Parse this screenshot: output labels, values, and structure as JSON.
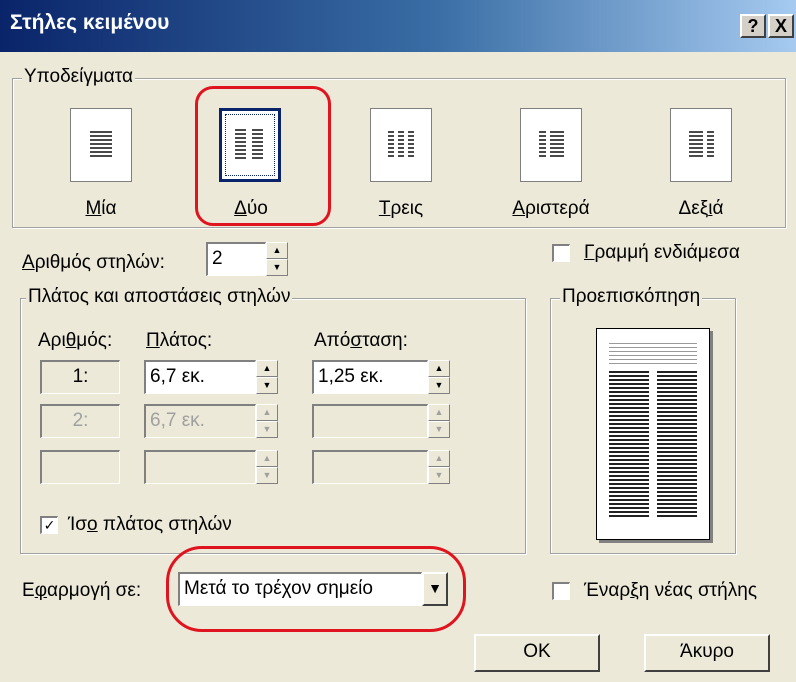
{
  "window": {
    "title": "Στήλες κειμένου",
    "help_label": "?",
    "close_label": "X"
  },
  "presets": {
    "legend": "Υποδείγματα",
    "items": [
      {
        "pre": "",
        "acc": "Μ",
        "post": "ία",
        "icon": "one-column-icon"
      },
      {
        "pre": "",
        "acc": "Δ",
        "post": "ύο",
        "icon": "two-columns-icon"
      },
      {
        "pre": "",
        "acc": "Τ",
        "post": "ρεις",
        "icon": "three-columns-icon"
      },
      {
        "pre": "",
        "acc": "Α",
        "post": "ριστερά",
        "icon": "left-columns-icon"
      },
      {
        "pre": "Δεξ",
        "acc": "ι",
        "post": "ά",
        "icon": "right-columns-icon"
      }
    ],
    "selected": "Δύο"
  },
  "num_columns": {
    "pre": "",
    "acc": "Α",
    "post": "ριθμός στηλών:",
    "value": "2"
  },
  "line_between": {
    "pre": "",
    "acc": "Γ",
    "post": "ραμμή ενδιάμεσα",
    "checked": false
  },
  "width_spacing": {
    "legend": "Πλάτος και αποστάσεις στηλών",
    "col_number_header": {
      "pre": "Αρι",
      "acc": "θ",
      "post": "μός:"
    },
    "width_header": {
      "pre": "",
      "acc": "Π",
      "post": "λάτος:"
    },
    "spacing_header": {
      "pre": "Από",
      "acc": "σ",
      "post": "ταση:"
    },
    "rows": [
      {
        "num": "1:",
        "width": "6,7 εκ.",
        "spacing": "1,25 εκ."
      },
      {
        "num": "2:",
        "width": "6,7 εκ.",
        "spacing": ""
      },
      {
        "num": "",
        "width": "",
        "spacing": ""
      }
    ]
  },
  "equal_width": {
    "pre": "Ίσ",
    "acc": "ο",
    "post": " πλάτος στηλών",
    "checked": true
  },
  "preview": {
    "legend": "Προεπισκόπηση"
  },
  "apply_to": {
    "pre": "Ε",
    "acc": "φ",
    "post": "αρμογή σε:",
    "value": "Μετά το τρέχον σημείο"
  },
  "start_new_column": {
    "pre": "Έναρ",
    "acc": "ξ",
    "post": "η νέας στήλης",
    "checked": false
  },
  "buttons": {
    "ok": "OK",
    "cancel": "Άκυρο"
  },
  "colors": {
    "annotation": "#e0141e",
    "titlebar_start": "#0a246a"
  }
}
